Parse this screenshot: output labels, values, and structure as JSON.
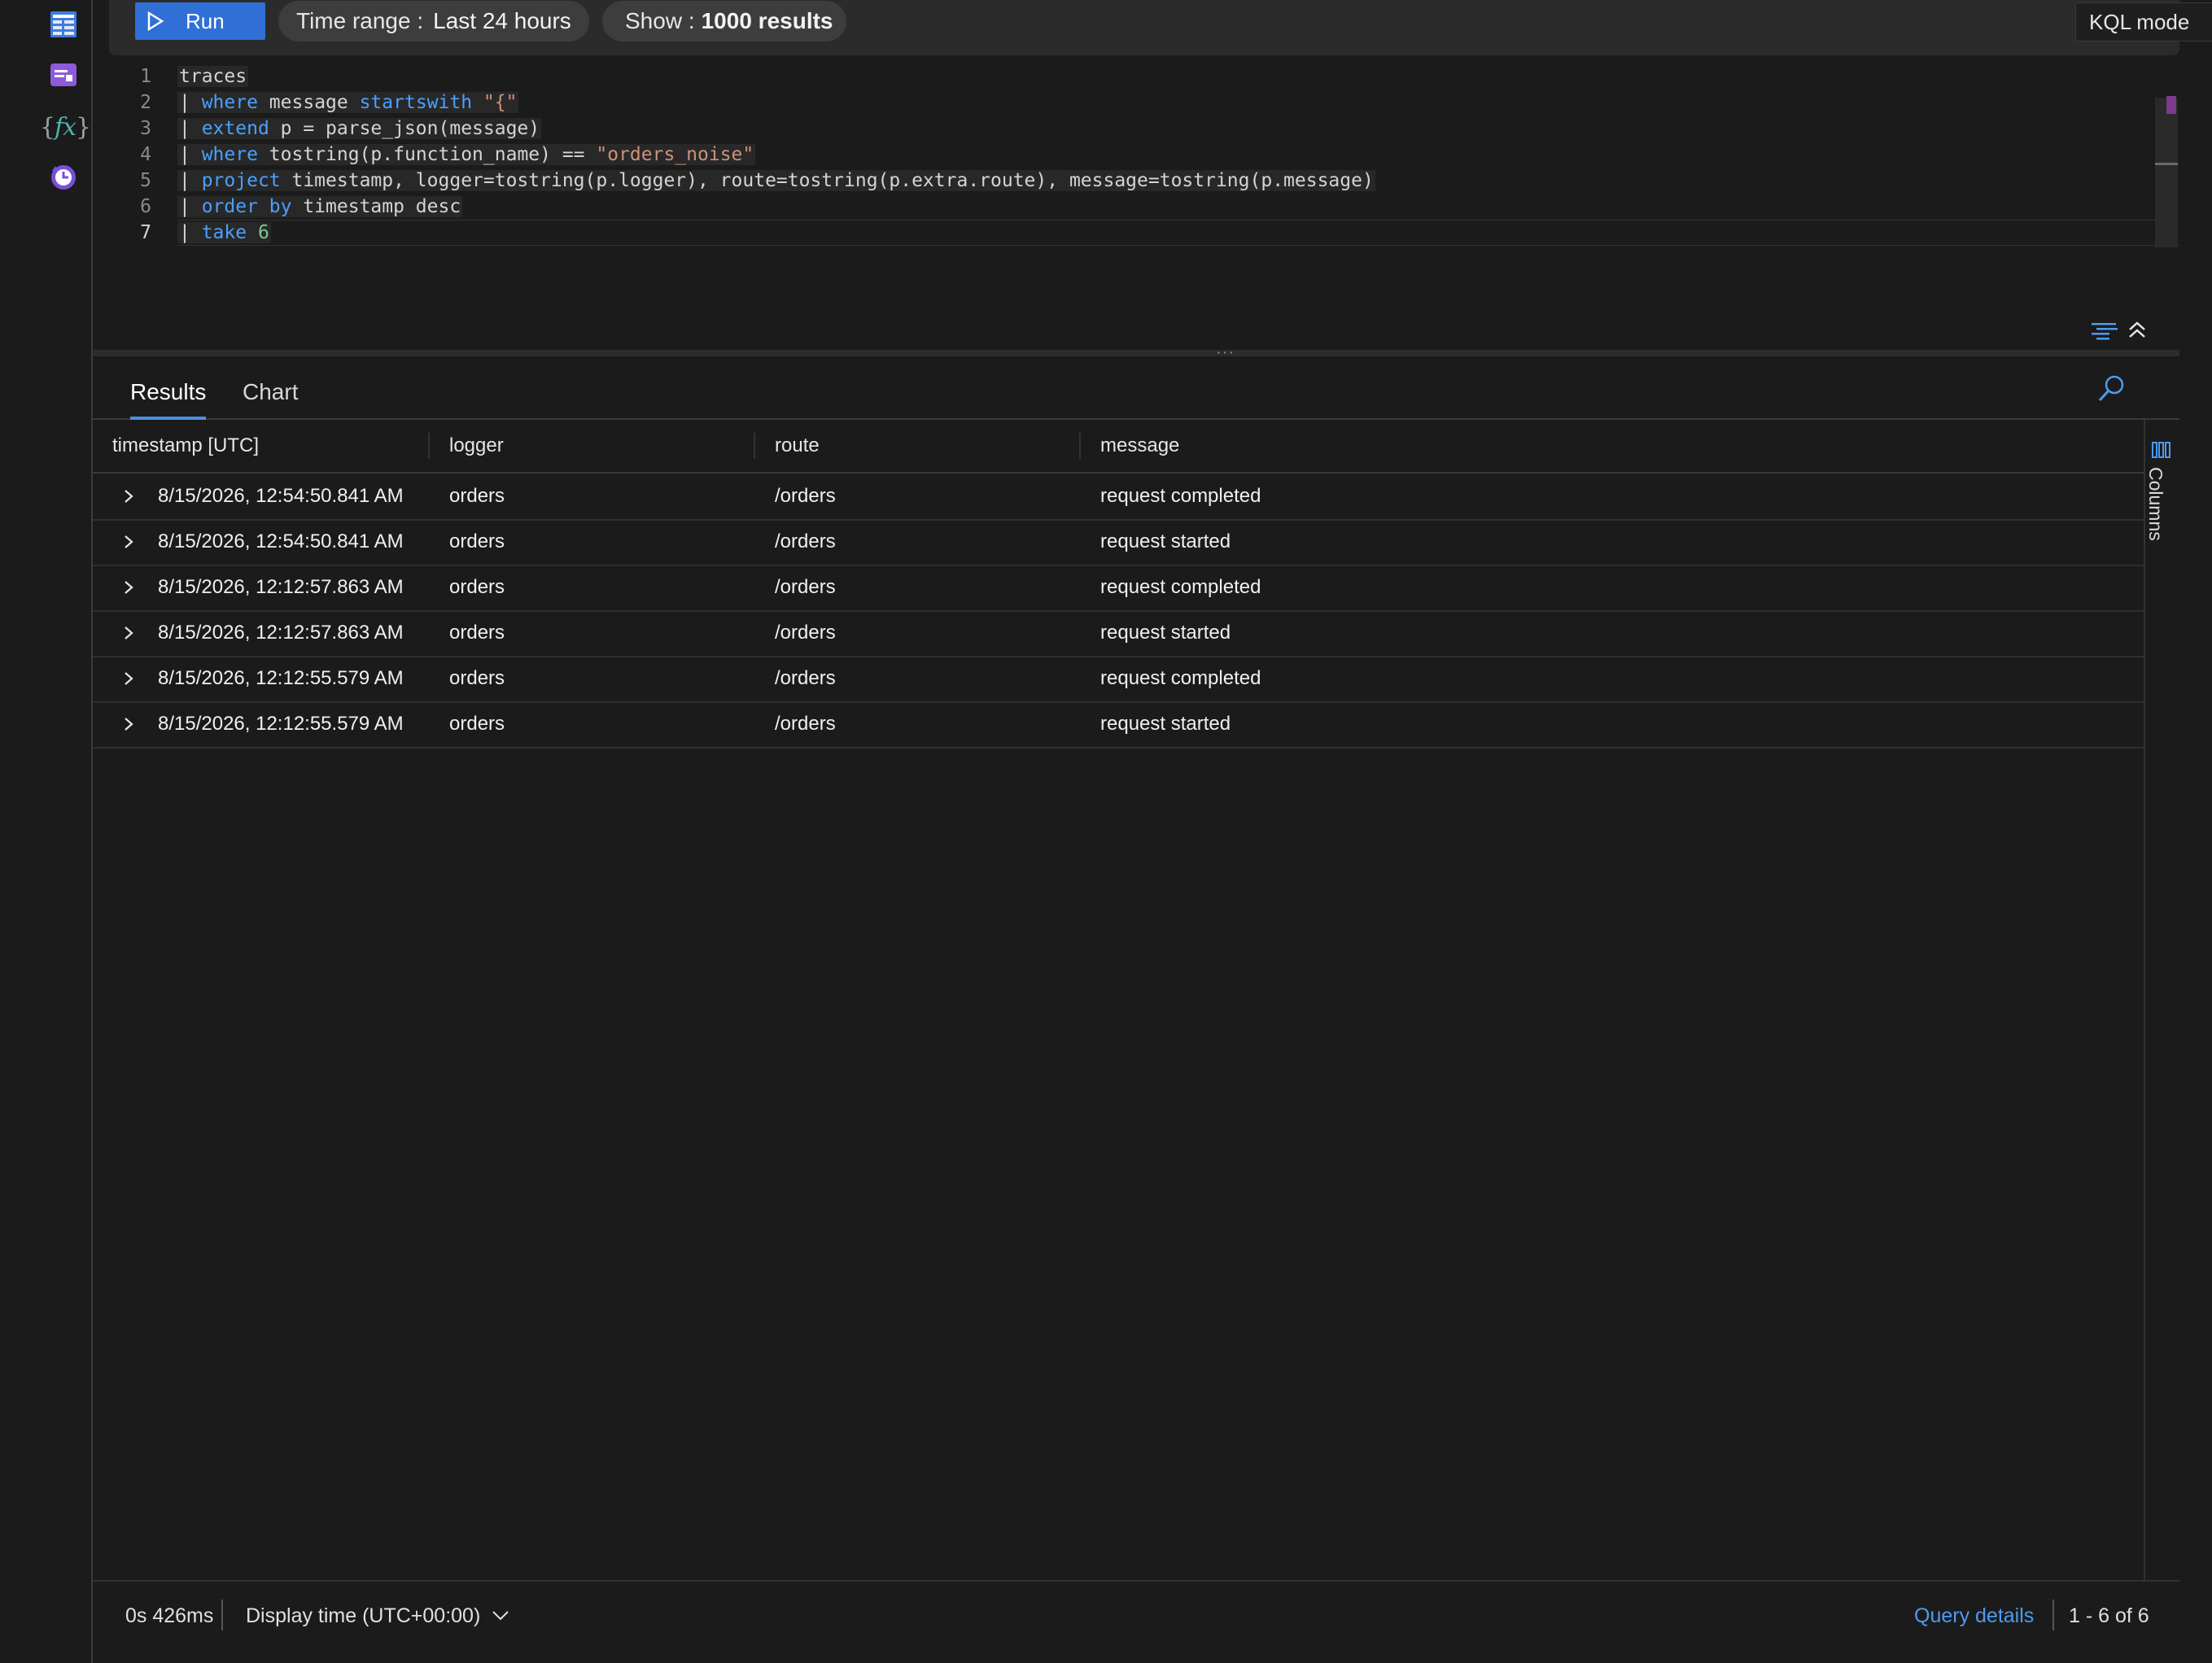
{
  "toolbar": {
    "run_label": "Run",
    "time_range_label": "Time range :",
    "time_range_value": "Last 24 hours",
    "show_label": "Show :",
    "show_value": "1000 results",
    "mode_label": "KQL mode"
  },
  "editor": {
    "lines": [
      {
        "num": "1"
      },
      {
        "num": "2"
      },
      {
        "num": "3"
      },
      {
        "num": "4"
      },
      {
        "num": "5"
      },
      {
        "num": "6"
      },
      {
        "num": "7"
      }
    ],
    "tokens": {
      "l1": "traces",
      "l2_pipe": "| ",
      "l2_kw": "where",
      "l2_mid": " message ",
      "l2_kw2": "startswith",
      "l2_sp": " ",
      "l2_str": "\"{\"",
      "l3_pipe": "| ",
      "l3_kw": "extend",
      "l3_rest": " p = parse_json(message)",
      "l4_pipe": "| ",
      "l4_kw": "where",
      "l4_mid": " tostring(p.function_name) == ",
      "l4_str": "\"orders_noise\"",
      "l5_pipe": "| ",
      "l5_kw": "project",
      "l5_rest": " timestamp, logger=tostring(p.logger), route=tostring(p.extra.route), message=tostring(p.message)",
      "l6_pipe": "| ",
      "l6_kw": "order by",
      "l6_rest": " timestamp desc",
      "l7_pipe": "| ",
      "l7_kw": "take",
      "l7_sp": " ",
      "l7_num": "6"
    }
  },
  "tabs": [
    {
      "label": "Results",
      "active": true
    },
    {
      "label": "Chart",
      "active": false
    }
  ],
  "grid": {
    "columns": [
      "timestamp [UTC]",
      "logger",
      "route",
      "message"
    ],
    "rows": [
      {
        "timestamp": "8/15/2026, 12:54:50.841 AM",
        "logger": "orders",
        "route": "/orders",
        "message": "request completed"
      },
      {
        "timestamp": "8/15/2026, 12:54:50.841 AM",
        "logger": "orders",
        "route": "/orders",
        "message": "request started"
      },
      {
        "timestamp": "8/15/2026, 12:12:57.863 AM",
        "logger": "orders",
        "route": "/orders",
        "message": "request completed"
      },
      {
        "timestamp": "8/15/2026, 12:12:57.863 AM",
        "logger": "orders",
        "route": "/orders",
        "message": "request started"
      },
      {
        "timestamp": "8/15/2026, 12:12:55.579 AM",
        "logger": "orders",
        "route": "/orders",
        "message": "request completed"
      },
      {
        "timestamp": "8/15/2026, 12:12:55.579 AM",
        "logger": "orders",
        "route": "/orders",
        "message": "request started"
      }
    ],
    "columns_panel_label": "Columns"
  },
  "footer": {
    "duration": "0s 426ms",
    "display_time": "Display time (UTC+00:00)",
    "query_details": "Query details",
    "count": "1 - 6 of 6"
  },
  "icons": {
    "rail": [
      "tables-icon",
      "queries-icon",
      "functions-icon",
      "history-icon"
    ],
    "accent": "#2f6fd6",
    "link_color": "#4d9bf0",
    "tab_indicator": "#4a90e2"
  }
}
